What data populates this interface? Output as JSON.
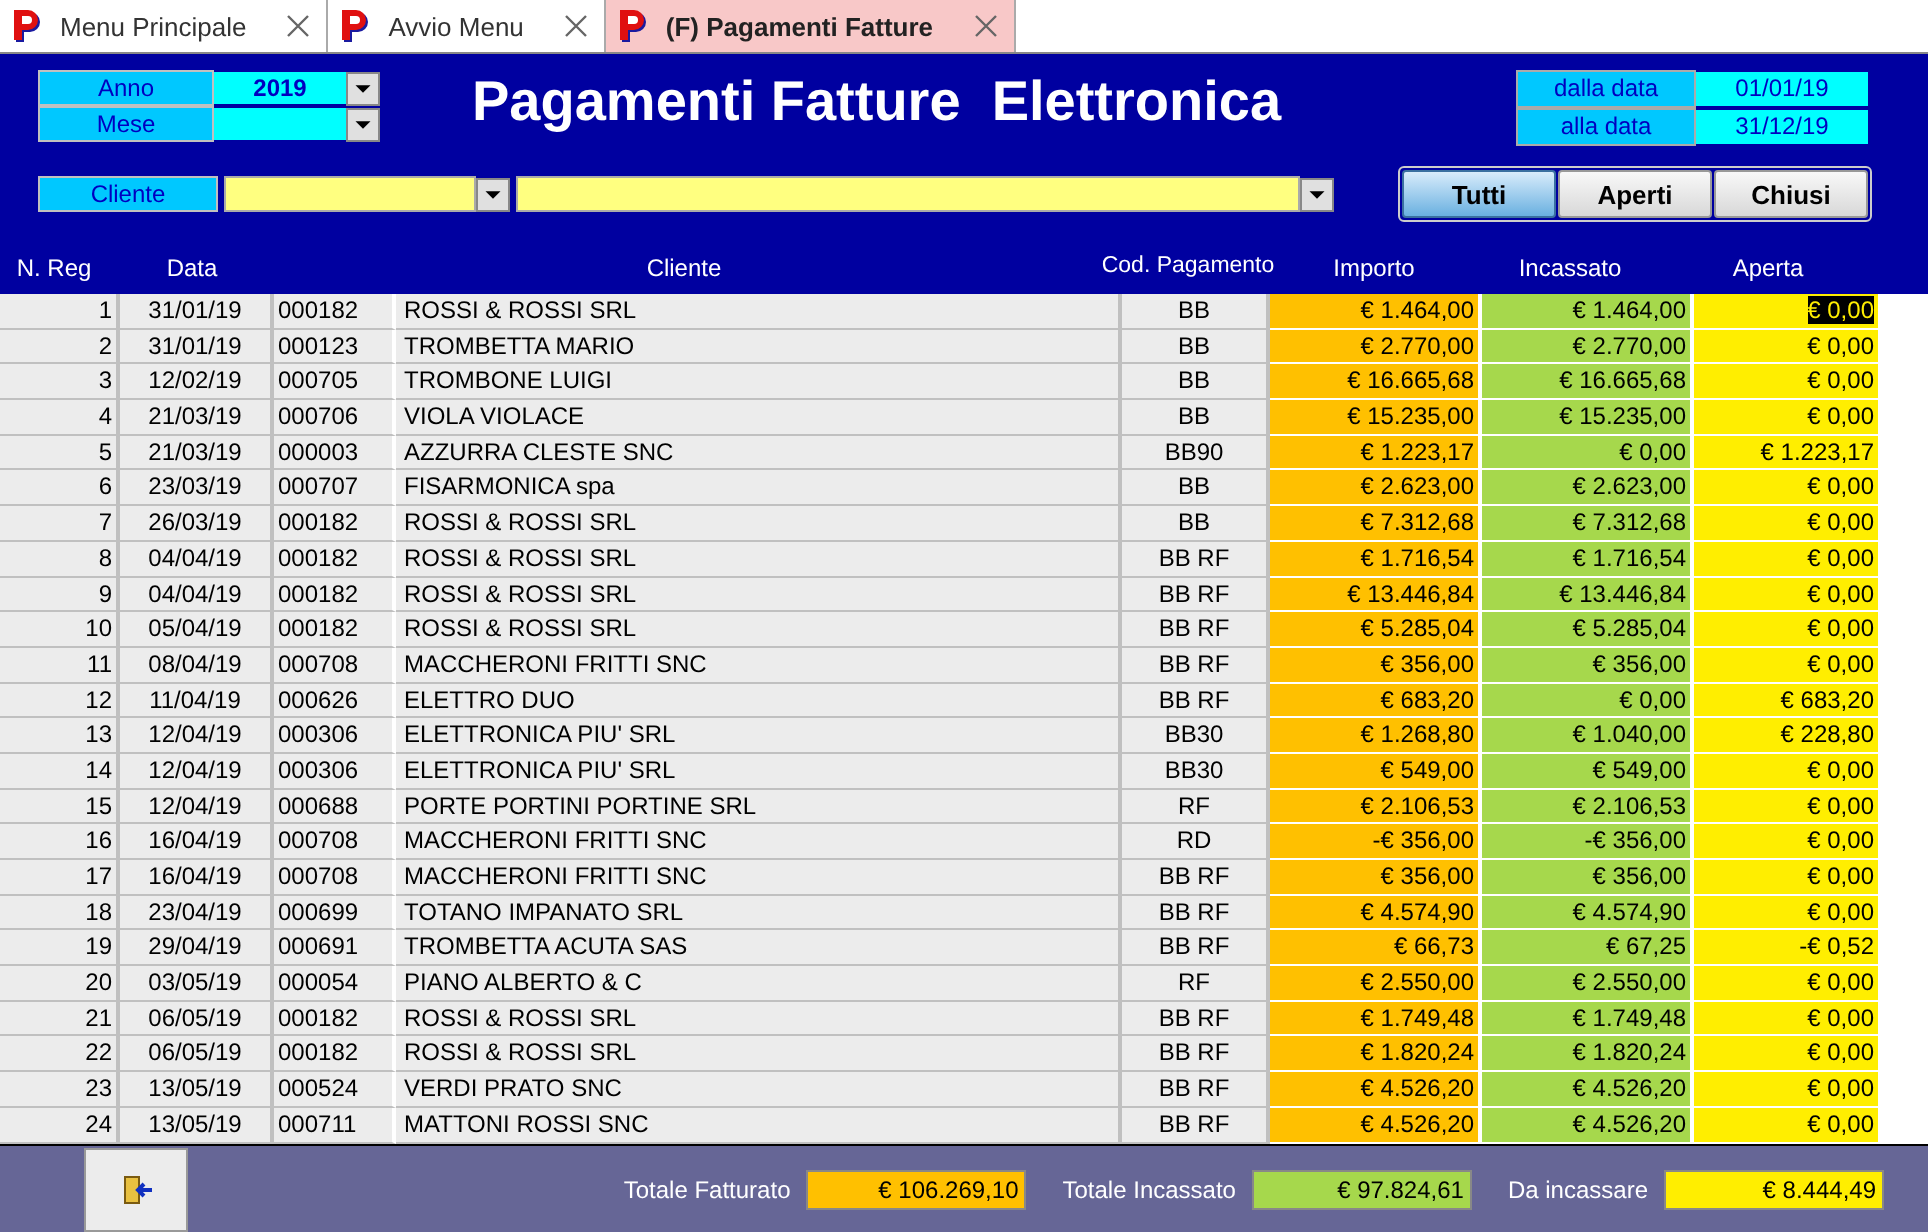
{
  "tabs": [
    {
      "label": "Menu Principale",
      "selected": false
    },
    {
      "label": "Avvio Menu",
      "selected": false
    },
    {
      "label": "(F) Pagamenti Fatture",
      "selected": true
    }
  ],
  "filters": {
    "anno_label": "Anno",
    "anno_value": "2019",
    "mese_label": "Mese",
    "cliente_label": "Cliente"
  },
  "title": "Pagamenti Fatture  Elettronica",
  "date_range": {
    "from_label": "dalla data",
    "from_value": "01/01/19",
    "to_label": "alla data",
    "to_value": "31/12/19"
  },
  "status_buttons": [
    {
      "label": "Tutti",
      "selected": true
    },
    {
      "label": "Aperti",
      "selected": false
    },
    {
      "label": "Chiusi",
      "selected": false
    }
  ],
  "table": {
    "columns": [
      "N. Reg",
      "Data",
      "Cliente",
      "Cod. Pagamento",
      "Importo",
      "Incassato",
      "Aperta"
    ],
    "rows": [
      {
        "n": "1",
        "data": "31/01/19",
        "codice": "000182",
        "cliente": "ROSSI & ROSSI SRL",
        "pagamento": "BB",
        "importo": "€ 1.464,00",
        "incassato": "€ 1.464,00",
        "aperta": "€ 0,00",
        "selected": true
      },
      {
        "n": "2",
        "data": "31/01/19",
        "codice": "000123",
        "cliente": "TROMBETTA MARIO",
        "pagamento": "BB",
        "importo": "€ 2.770,00",
        "incassato": "€ 2.770,00",
        "aperta": "€ 0,00",
        "selected": false
      },
      {
        "n": "3",
        "data": "12/02/19",
        "codice": "000705",
        "cliente": "TROMBONE LUIGI",
        "pagamento": "BB",
        "importo": "€ 16.665,68",
        "incassato": "€ 16.665,68",
        "aperta": "€ 0,00",
        "selected": false
      },
      {
        "n": "4",
        "data": "21/03/19",
        "codice": "000706",
        "cliente": "VIOLA VIOLACE",
        "pagamento": "BB",
        "importo": "€ 15.235,00",
        "incassato": "€ 15.235,00",
        "aperta": "€ 0,00",
        "selected": false
      },
      {
        "n": "5",
        "data": "21/03/19",
        "codice": "000003",
        "cliente": "AZZURRA CLESTE SNC",
        "pagamento": "BB90",
        "importo": "€ 1.223,17",
        "incassato": "€ 0,00",
        "aperta": "€ 1.223,17",
        "selected": false
      },
      {
        "n": "6",
        "data": "23/03/19",
        "codice": "000707",
        "cliente": "FISARMONICA spa",
        "pagamento": "BB",
        "importo": "€ 2.623,00",
        "incassato": "€ 2.623,00",
        "aperta": "€ 0,00",
        "selected": false
      },
      {
        "n": "7",
        "data": "26/03/19",
        "codice": "000182",
        "cliente": "ROSSI & ROSSI SRL",
        "pagamento": "BB",
        "importo": "€ 7.312,68",
        "incassato": "€ 7.312,68",
        "aperta": "€ 0,00",
        "selected": false
      },
      {
        "n": "8",
        "data": "04/04/19",
        "codice": "000182",
        "cliente": "ROSSI & ROSSI SRL",
        "pagamento": "BB RF",
        "importo": "€ 1.716,54",
        "incassato": "€ 1.716,54",
        "aperta": "€ 0,00",
        "selected": false
      },
      {
        "n": "9",
        "data": "04/04/19",
        "codice": "000182",
        "cliente": "ROSSI & ROSSI SRL",
        "pagamento": "BB RF",
        "importo": "€ 13.446,84",
        "incassato": "€ 13.446,84",
        "aperta": "€ 0,00",
        "selected": false
      },
      {
        "n": "10",
        "data": "05/04/19",
        "codice": "000182",
        "cliente": "ROSSI & ROSSI SRL",
        "pagamento": "BB RF",
        "importo": "€ 5.285,04",
        "incassato": "€ 5.285,04",
        "aperta": "€ 0,00",
        "selected": false
      },
      {
        "n": "11",
        "data": "08/04/19",
        "codice": "000708",
        "cliente": "MACCHERONI FRITTI SNC",
        "pagamento": "BB RF",
        "importo": "€ 356,00",
        "incassato": "€ 356,00",
        "aperta": "€ 0,00",
        "selected": false
      },
      {
        "n": "12",
        "data": "11/04/19",
        "codice": "000626",
        "cliente": "ELETTRO DUO",
        "pagamento": "BB RF",
        "importo": "€ 683,20",
        "incassato": "€ 0,00",
        "aperta": "€ 683,20",
        "selected": false
      },
      {
        "n": "13",
        "data": "12/04/19",
        "codice": "000306",
        "cliente": "ELETTRONICA PIU' SRL",
        "pagamento": "BB30",
        "importo": "€ 1.268,80",
        "incassato": "€ 1.040,00",
        "aperta": "€ 228,80",
        "selected": false
      },
      {
        "n": "14",
        "data": "12/04/19",
        "codice": "000306",
        "cliente": "ELETTRONICA PIU' SRL",
        "pagamento": "BB30",
        "importo": "€ 549,00",
        "incassato": "€ 549,00",
        "aperta": "€ 0,00",
        "selected": false
      },
      {
        "n": "15",
        "data": "12/04/19",
        "codice": "000688",
        "cliente": "PORTE PORTINI PORTINE SRL",
        "pagamento": "RF",
        "importo": "€ 2.106,53",
        "incassato": "€ 2.106,53",
        "aperta": "€ 0,00",
        "selected": false
      },
      {
        "n": "16",
        "data": "16/04/19",
        "codice": "000708",
        "cliente": "MACCHERONI FRITTI SNC",
        "pagamento": "RD",
        "importo": "-€ 356,00",
        "incassato": "-€ 356,00",
        "aperta": "€ 0,00",
        "selected": false
      },
      {
        "n": "17",
        "data": "16/04/19",
        "codice": "000708",
        "cliente": "MACCHERONI FRITTI SNC",
        "pagamento": "BB RF",
        "importo": "€ 356,00",
        "incassato": "€ 356,00",
        "aperta": "€ 0,00",
        "selected": false
      },
      {
        "n": "18",
        "data": "23/04/19",
        "codice": "000699",
        "cliente": "TOTANO IMPANATO SRL",
        "pagamento": "BB RF",
        "importo": "€ 4.574,90",
        "incassato": "€ 4.574,90",
        "aperta": "€ 0,00",
        "selected": false
      },
      {
        "n": "19",
        "data": "29/04/19",
        "codice": "000691",
        "cliente": "TROMBETTA ACUTA SAS",
        "pagamento": "BB RF",
        "importo": "€ 66,73",
        "incassato": "€ 67,25",
        "aperta": "-€ 0,52",
        "selected": false
      },
      {
        "n": "20",
        "data": "03/05/19",
        "codice": "000054",
        "cliente": "PIANO ALBERTO & C",
        "pagamento": "RF",
        "importo": "€ 2.550,00",
        "incassato": "€ 2.550,00",
        "aperta": "€ 0,00",
        "selected": false
      },
      {
        "n": "21",
        "data": "06/05/19",
        "codice": "000182",
        "cliente": "ROSSI & ROSSI SRL",
        "pagamento": "BB RF",
        "importo": "€ 1.749,48",
        "incassato": "€ 1.749,48",
        "aperta": "€ 0,00",
        "selected": false
      },
      {
        "n": "22",
        "data": "06/05/19",
        "codice": "000182",
        "cliente": "ROSSI & ROSSI SRL",
        "pagamento": "BB RF",
        "importo": "€ 1.820,24",
        "incassato": "€ 1.820,24",
        "aperta": "€ 0,00",
        "selected": false
      },
      {
        "n": "23",
        "data": "13/05/19",
        "codice": "000524",
        "cliente": "VERDI PRATO SNC",
        "pagamento": "BB RF",
        "importo": "€ 4.526,20",
        "incassato": "€ 4.526,20",
        "aperta": "€ 0,00",
        "selected": false
      },
      {
        "n": "24",
        "data": "13/05/19",
        "codice": "000711",
        "cliente": "MATTONI ROSSI SNC",
        "pagamento": "BB RF",
        "importo": "€ 4.526,20",
        "incassato": "€ 4.526,20",
        "aperta": "€ 0,00",
        "selected": false
      }
    ]
  },
  "totals": [
    {
      "label": "Totale Fatturato",
      "value": "€ 106.269,10",
      "color": "#ffc000"
    },
    {
      "label": "Totale Incassato",
      "value": "€ 97.824,61",
      "color": "#a6d84c"
    },
    {
      "label": "Da incassare",
      "value": "€ 8.444,49",
      "color": "#ffee00"
    }
  ]
}
